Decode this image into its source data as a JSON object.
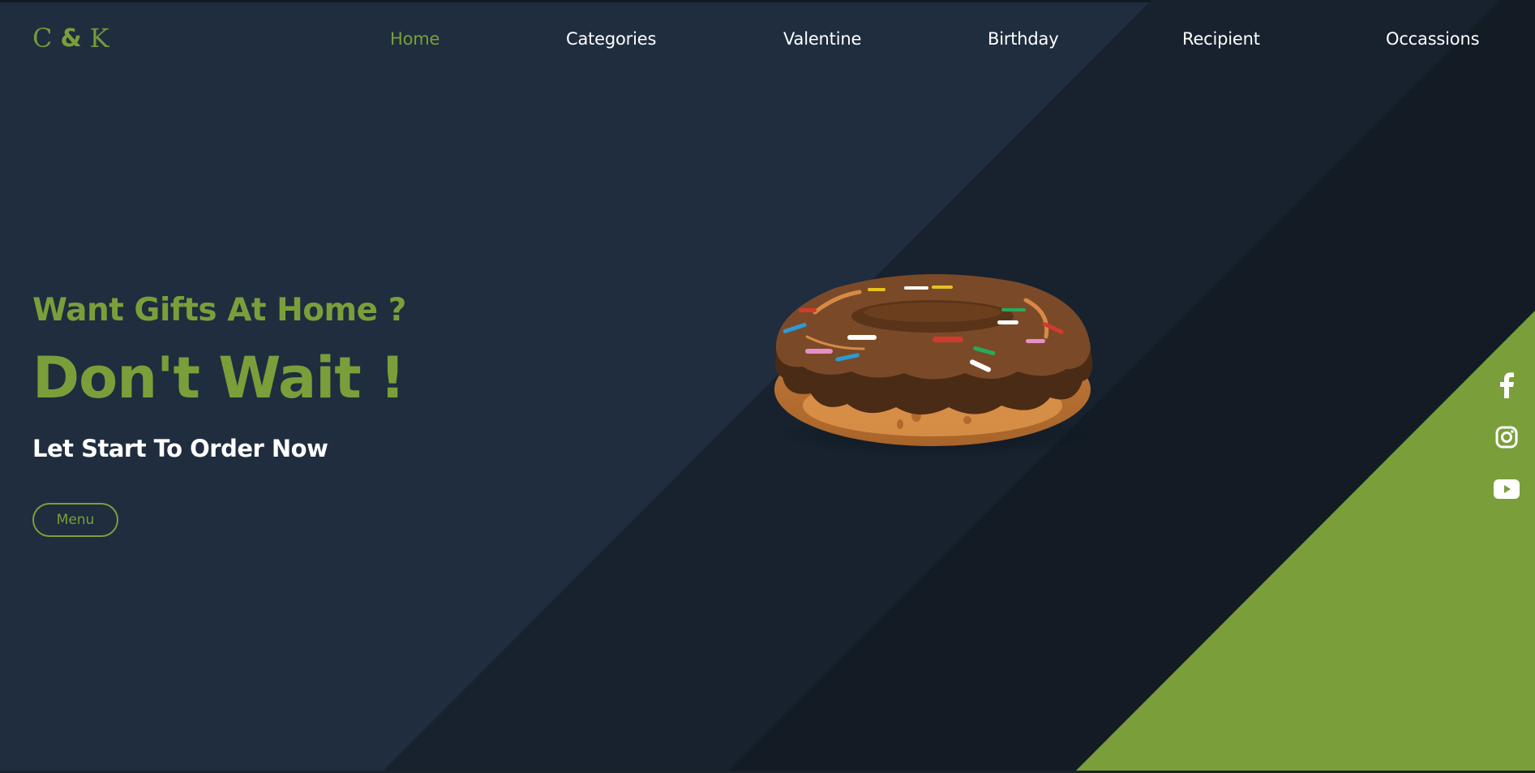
{
  "logo": {
    "left": "C",
    "amp": "&",
    "right": "K"
  },
  "nav": {
    "items": [
      {
        "label": "Home",
        "active": true
      },
      {
        "label": "Categories",
        "active": false
      },
      {
        "label": "Valentine",
        "active": false
      },
      {
        "label": "Birthday",
        "active": false
      },
      {
        "label": "Recipient",
        "active": false
      },
      {
        "label": "Occassions",
        "active": false
      }
    ]
  },
  "hero": {
    "tagline": "Want Gifts At Home ?",
    "headline": "Don't Wait !",
    "subline": "Let Start To Order Now",
    "menu_button": "Menu"
  },
  "social": {
    "icons": [
      "facebook-icon",
      "instagram-icon",
      "youtube-icon"
    ]
  },
  "colors": {
    "background": "#1f2d3f",
    "dark_band": "#141e28",
    "accent": "#7a9f3a",
    "text": "#ffffff"
  }
}
